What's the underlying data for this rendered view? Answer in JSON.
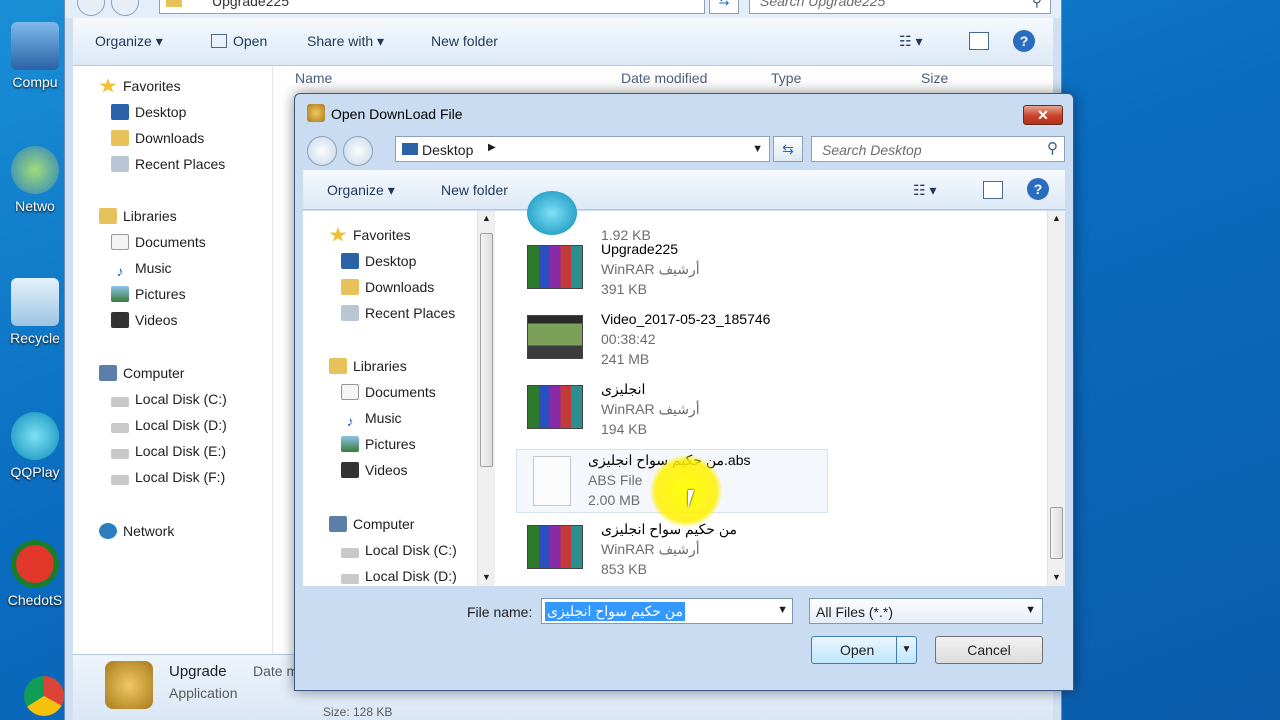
{
  "desktop": {
    "icons": [
      {
        "label": "Compu",
        "icon": "computer-icon"
      },
      {
        "label": "Netwo",
        "icon": "network-icon"
      },
      {
        "label": "Recycle",
        "icon": "recycle-bin-icon"
      },
      {
        "label": "QQPlay",
        "icon": "qqplayer-icon"
      },
      {
        "label": "ChedotS",
        "icon": "chedot-icon"
      }
    ]
  },
  "background_window": {
    "address": "Upgrade225",
    "search_placeholder": "Search Upgrade225",
    "toolbar": {
      "organize": "Organize",
      "open": "Open",
      "share_with": "Share with",
      "new_folder": "New folder"
    },
    "columns": {
      "name": "Name",
      "date_modified": "Date modified",
      "type": "Type",
      "size": "Size"
    },
    "nav": {
      "favorites": "Favorites",
      "desktop": "Desktop",
      "downloads": "Downloads",
      "recent_places": "Recent Places",
      "libraries": "Libraries",
      "documents": "Documents",
      "music": "Music",
      "pictures": "Pictures",
      "videos": "Videos",
      "computer": "Computer",
      "disk_c": "Local Disk (C:)",
      "disk_d": "Local Disk (D:)",
      "disk_e": "Local Disk (E:)",
      "disk_f": "Local Disk (F:)",
      "network": "Network"
    },
    "details": {
      "name": "Upgrade",
      "type": "Application",
      "date_label": "Date m",
      "size_label": "Size: 128 KB"
    }
  },
  "dialog": {
    "title": "Open DownLoad File",
    "close_label": "✕",
    "address": "Desktop",
    "search_placeholder": "Search Desktop",
    "toolbar": {
      "organize": "Organize",
      "new_folder": "New folder"
    },
    "nav": {
      "favorites": "Favorites",
      "desktop": "Desktop",
      "downloads": "Downloads",
      "recent_places": "Recent Places",
      "libraries": "Libraries",
      "documents": "Documents",
      "music": "Music",
      "pictures": "Pictures",
      "videos": "Videos",
      "computer": "Computer",
      "disk_c": "Local Disk (C:)",
      "disk_d": "Local Disk (D:)"
    },
    "files": [
      {
        "name": "",
        "line2": "",
        "line3": "1.92 KB"
      },
      {
        "name": "Upgrade225",
        "line2": "WinRAR أرشيف",
        "line3": "391 KB"
      },
      {
        "name": "Video_2017-05-23_185746",
        "line2": "00:38:42",
        "line3": "241 MB"
      },
      {
        "name": "انجليزى",
        "line2": "WinRAR أرشيف",
        "line3": "194 KB"
      },
      {
        "name": "من حكيم سواح انجليزى.abs",
        "line2": "ABS File",
        "line3": "2.00 MB"
      },
      {
        "name": "من حكيم سواح انجليزى",
        "line2": "WinRAR أرشيف",
        "line3": "853 KB"
      }
    ],
    "file_name_label": "File name:",
    "file_name_value": "من حكيم سواح انجليزى",
    "filter_value": "All Files (*.*)",
    "open_button": "Open",
    "cancel_button": "Cancel"
  }
}
